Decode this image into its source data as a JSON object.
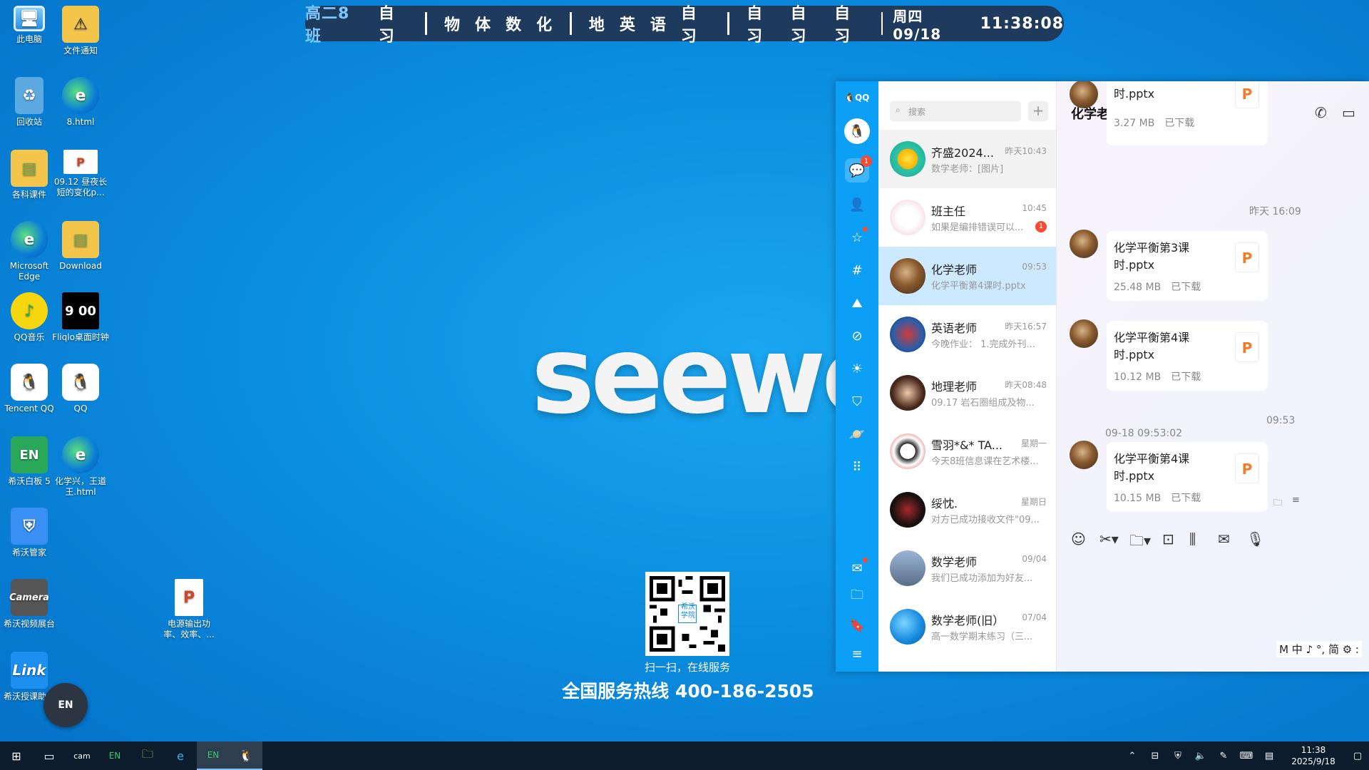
{
  "desktop_icons": [
    {
      "label": "此电脑",
      "icon": "computer-icon"
    },
    {
      "label": "文件通知",
      "icon": "folder-warning-icon"
    },
    {
      "label": "回收站",
      "icon": "recycle-bin-icon"
    },
    {
      "label": "8.html",
      "icon": "edge-icon"
    },
    {
      "label": "各科课件",
      "icon": "folder-icon"
    },
    {
      "label": "09.12 昼夜长短的变化p...",
      "icon": "pptx-icon"
    },
    {
      "label": "Microsoft Edge",
      "icon": "edge-icon"
    },
    {
      "label": "Download",
      "icon": "folder-icon"
    },
    {
      "label": "QQ音乐",
      "icon": "qq-music-icon"
    },
    {
      "label": "Fliqlo桌面时钟",
      "icon": "clock-icon"
    },
    {
      "label": "Tencent QQ",
      "icon": "qq-penguin-icon"
    },
    {
      "label": "QQ",
      "icon": "qq-penguin-icon"
    },
    {
      "label": "希沃白板 5",
      "icon": "easinote-icon"
    },
    {
      "label": "化学兴，王道王.html",
      "icon": "edge-icon"
    },
    {
      "label": "希沃管家",
      "icon": "shield-icon"
    },
    {
      "label": "希沃视频展台",
      "icon": "camera-icon"
    },
    {
      "label": "电源输出功率、效率、...",
      "icon": "pptx-icon"
    },
    {
      "label": "希沃授课助手",
      "icon": "link-icon"
    }
  ],
  "fliqlo_digits": "9 00",
  "schedule": {
    "class_name": "高二8班",
    "groups": [
      [
        "自习"
      ],
      [
        "物",
        "体",
        "数",
        "化"
      ],
      [
        "地",
        "英",
        "语",
        "自习"
      ],
      [
        "自习",
        "自习",
        "自习"
      ]
    ],
    "date": "周四 09/18",
    "time": "11:38:08"
  },
  "wallpaper": {
    "logo": "seewo",
    "qr_caption": "扫一扫，在线服务",
    "qr_center_text": "希沃学院",
    "hotline": "全国服务热线 400-186-2505",
    "float_badge": "EN"
  },
  "qq": {
    "logo": "QQ",
    "rail_badge": "1",
    "search_placeholder": "搜索",
    "add_label": "+",
    "conversations": [
      {
        "name": "齐盛2024...",
        "time": "昨天10:43",
        "preview": "数学老师：[图片]",
        "badge": ""
      },
      {
        "name": "班主任",
        "time": "10:45",
        "preview": "如果是编排错误可以...",
        "badge": "1"
      },
      {
        "name": "化学老师",
        "time": "09:53",
        "preview": "化学平衡第4课时.pptx",
        "badge": ""
      },
      {
        "name": "英语老师",
        "time": "昨天16:57",
        "preview": "今晚作业： 1.完成外刊...",
        "badge": ""
      },
      {
        "name": "地理老师",
        "time": "昨天08:48",
        "preview": "09.17 岩石圈组成及物...",
        "badge": ""
      },
      {
        "name": "雪羽*&* TA...",
        "time": "星期一",
        "preview": "今天8班信息课在艺术楼...",
        "badge": ""
      },
      {
        "name": "绥忱.",
        "time": "星期日",
        "preview": "对方已成功接收文件\"09...",
        "badge": ""
      },
      {
        "name": "数学老师",
        "time": "09/04",
        "preview": "我们已成功添加为好友...",
        "badge": ""
      },
      {
        "name": "数学老师(旧）",
        "time": "07/04",
        "preview": "高一数学期末练习（三...",
        "badge": ""
      }
    ],
    "chat": {
      "title": "化学老师",
      "messages": [
        {
          "file": "时.pptx",
          "size": "3.27 MB",
          "status": "已下载"
        },
        {
          "file": "化学平衡第3课时.pptx",
          "size": "25.48 MB",
          "status": "已下载"
        },
        {
          "file": "化学平衡第4课时.pptx",
          "size": "10.12 MB",
          "status": "已下载"
        },
        {
          "file": "化学平衡第4课时.pptx",
          "size": "10.15 MB",
          "status": "已下载"
        }
      ],
      "timestamps": [
        "昨天 16:09",
        "09:53"
      ],
      "sender_time": "09-18 09:53:02",
      "ppt_glyph": "P"
    },
    "ime_status": "M 中 ♪ °, 简 ⚙ :"
  },
  "taskbar": {
    "clock_time": "11:38",
    "clock_date": "2025/9/18"
  },
  "colors": {
    "accent": "#0b9ff6",
    "selected": "#cde9ff",
    "badge": "#f74c31",
    "ppt": "#f57a2a",
    "schedule_bg": "#1e3a5c"
  }
}
